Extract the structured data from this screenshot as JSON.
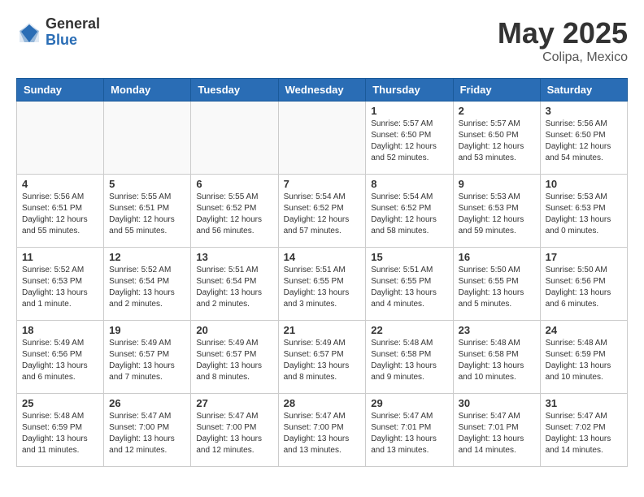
{
  "header": {
    "logo_general": "General",
    "logo_blue": "Blue",
    "month_year": "May 2025",
    "location": "Colipa, Mexico"
  },
  "weekdays": [
    "Sunday",
    "Monday",
    "Tuesday",
    "Wednesday",
    "Thursday",
    "Friday",
    "Saturday"
  ],
  "weeks": [
    [
      {
        "day": "",
        "info": ""
      },
      {
        "day": "",
        "info": ""
      },
      {
        "day": "",
        "info": ""
      },
      {
        "day": "",
        "info": ""
      },
      {
        "day": "1",
        "info": "Sunrise: 5:57 AM\nSunset: 6:50 PM\nDaylight: 12 hours\nand 52 minutes."
      },
      {
        "day": "2",
        "info": "Sunrise: 5:57 AM\nSunset: 6:50 PM\nDaylight: 12 hours\nand 53 minutes."
      },
      {
        "day": "3",
        "info": "Sunrise: 5:56 AM\nSunset: 6:50 PM\nDaylight: 12 hours\nand 54 minutes."
      }
    ],
    [
      {
        "day": "4",
        "info": "Sunrise: 5:56 AM\nSunset: 6:51 PM\nDaylight: 12 hours\nand 55 minutes."
      },
      {
        "day": "5",
        "info": "Sunrise: 5:55 AM\nSunset: 6:51 PM\nDaylight: 12 hours\nand 55 minutes."
      },
      {
        "day": "6",
        "info": "Sunrise: 5:55 AM\nSunset: 6:52 PM\nDaylight: 12 hours\nand 56 minutes."
      },
      {
        "day": "7",
        "info": "Sunrise: 5:54 AM\nSunset: 6:52 PM\nDaylight: 12 hours\nand 57 minutes."
      },
      {
        "day": "8",
        "info": "Sunrise: 5:54 AM\nSunset: 6:52 PM\nDaylight: 12 hours\nand 58 minutes."
      },
      {
        "day": "9",
        "info": "Sunrise: 5:53 AM\nSunset: 6:53 PM\nDaylight: 12 hours\nand 59 minutes."
      },
      {
        "day": "10",
        "info": "Sunrise: 5:53 AM\nSunset: 6:53 PM\nDaylight: 13 hours\nand 0 minutes."
      }
    ],
    [
      {
        "day": "11",
        "info": "Sunrise: 5:52 AM\nSunset: 6:53 PM\nDaylight: 13 hours\nand 1 minute."
      },
      {
        "day": "12",
        "info": "Sunrise: 5:52 AM\nSunset: 6:54 PM\nDaylight: 13 hours\nand 2 minutes."
      },
      {
        "day": "13",
        "info": "Sunrise: 5:51 AM\nSunset: 6:54 PM\nDaylight: 13 hours\nand 2 minutes."
      },
      {
        "day": "14",
        "info": "Sunrise: 5:51 AM\nSunset: 6:55 PM\nDaylight: 13 hours\nand 3 minutes."
      },
      {
        "day": "15",
        "info": "Sunrise: 5:51 AM\nSunset: 6:55 PM\nDaylight: 13 hours\nand 4 minutes."
      },
      {
        "day": "16",
        "info": "Sunrise: 5:50 AM\nSunset: 6:55 PM\nDaylight: 13 hours\nand 5 minutes."
      },
      {
        "day": "17",
        "info": "Sunrise: 5:50 AM\nSunset: 6:56 PM\nDaylight: 13 hours\nand 6 minutes."
      }
    ],
    [
      {
        "day": "18",
        "info": "Sunrise: 5:49 AM\nSunset: 6:56 PM\nDaylight: 13 hours\nand 6 minutes."
      },
      {
        "day": "19",
        "info": "Sunrise: 5:49 AM\nSunset: 6:57 PM\nDaylight: 13 hours\nand 7 minutes."
      },
      {
        "day": "20",
        "info": "Sunrise: 5:49 AM\nSunset: 6:57 PM\nDaylight: 13 hours\nand 8 minutes."
      },
      {
        "day": "21",
        "info": "Sunrise: 5:49 AM\nSunset: 6:57 PM\nDaylight: 13 hours\nand 8 minutes."
      },
      {
        "day": "22",
        "info": "Sunrise: 5:48 AM\nSunset: 6:58 PM\nDaylight: 13 hours\nand 9 minutes."
      },
      {
        "day": "23",
        "info": "Sunrise: 5:48 AM\nSunset: 6:58 PM\nDaylight: 13 hours\nand 10 minutes."
      },
      {
        "day": "24",
        "info": "Sunrise: 5:48 AM\nSunset: 6:59 PM\nDaylight: 13 hours\nand 10 minutes."
      }
    ],
    [
      {
        "day": "25",
        "info": "Sunrise: 5:48 AM\nSunset: 6:59 PM\nDaylight: 13 hours\nand 11 minutes."
      },
      {
        "day": "26",
        "info": "Sunrise: 5:47 AM\nSunset: 7:00 PM\nDaylight: 13 hours\nand 12 minutes."
      },
      {
        "day": "27",
        "info": "Sunrise: 5:47 AM\nSunset: 7:00 PM\nDaylight: 13 hours\nand 12 minutes."
      },
      {
        "day": "28",
        "info": "Sunrise: 5:47 AM\nSunset: 7:00 PM\nDaylight: 13 hours\nand 13 minutes."
      },
      {
        "day": "29",
        "info": "Sunrise: 5:47 AM\nSunset: 7:01 PM\nDaylight: 13 hours\nand 13 minutes."
      },
      {
        "day": "30",
        "info": "Sunrise: 5:47 AM\nSunset: 7:01 PM\nDaylight: 13 hours\nand 14 minutes."
      },
      {
        "day": "31",
        "info": "Sunrise: 5:47 AM\nSunset: 7:02 PM\nDaylight: 13 hours\nand 14 minutes."
      }
    ]
  ]
}
